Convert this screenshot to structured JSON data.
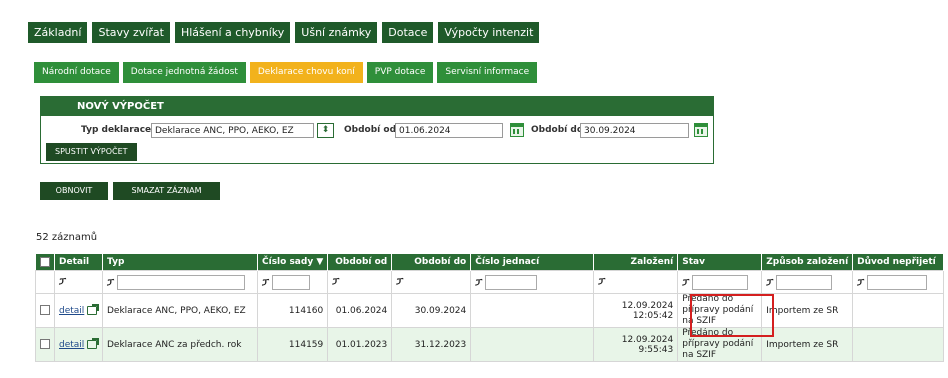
{
  "nav": {
    "main_tabs": [
      "Základní",
      "Stavy zvířat",
      "Hlášení a chybníky",
      "Ušní známky",
      "Dotace",
      "Výpočty intenzit"
    ],
    "sub_tabs": [
      "Národní dotace",
      "Dotace jednotná žádost",
      "Deklarace chovu koní",
      "PVP dotace",
      "Servisní informace"
    ],
    "active_sub_tab": "Deklarace chovu koní"
  },
  "panel": {
    "title": "NOVÝ VÝPOČET",
    "type_label": "Typ deklarace",
    "type_value": "Deklarace ANC, PPO, AEKO, EZ",
    "from_label": "Období od",
    "from_value": "01.06.2024",
    "to_label": "Období do",
    "to_value": "30.09.2024",
    "run_button": "SPUSTIT VÝPOČET"
  },
  "actions": {
    "refresh": "OBNOVIT",
    "delete": "SMAZAT ZÁZNAM"
  },
  "record_count": "52 záznamů",
  "table": {
    "columns": [
      "Detail",
      "Typ",
      "Číslo sady ▼",
      "Období od",
      "Období do",
      "Číslo jednací",
      "Založení",
      "Stav",
      "Způsob založení",
      "Důvod nepřijetí"
    ],
    "filter_icon": "funnel-icon",
    "rows": [
      {
        "detail": "detail",
        "typ": "Deklarace ANC, PPO, AEKO, EZ",
        "cislo_sady": "114160",
        "od": "01.06.2024",
        "do": "30.09.2024",
        "cislo_jednaci": "",
        "zalozeni": "12.09.2024 12:05:42",
        "stav": "Předáno do přípravy podání na SZIF",
        "zpusob": "Importem ze SR",
        "duvod": ""
      },
      {
        "detail": "detail",
        "typ": "Deklarace ANC za předch. rok",
        "cislo_sady": "114159",
        "od": "01.01.2023",
        "do": "31.12.2023",
        "cislo_jednaci": "",
        "zalozeni": "12.09.2024 9:55:43",
        "stav": "Předáno do přípravy podání na SZIF",
        "zpusob": "Importem ze SR",
        "duvod": ""
      }
    ]
  },
  "colors": {
    "nav_dark": "#1f5a2a",
    "sub_green": "#2f8f3a",
    "sub_active": "#f2b21c",
    "header_green": "#2a6c34",
    "highlight": "#d41f1f"
  }
}
